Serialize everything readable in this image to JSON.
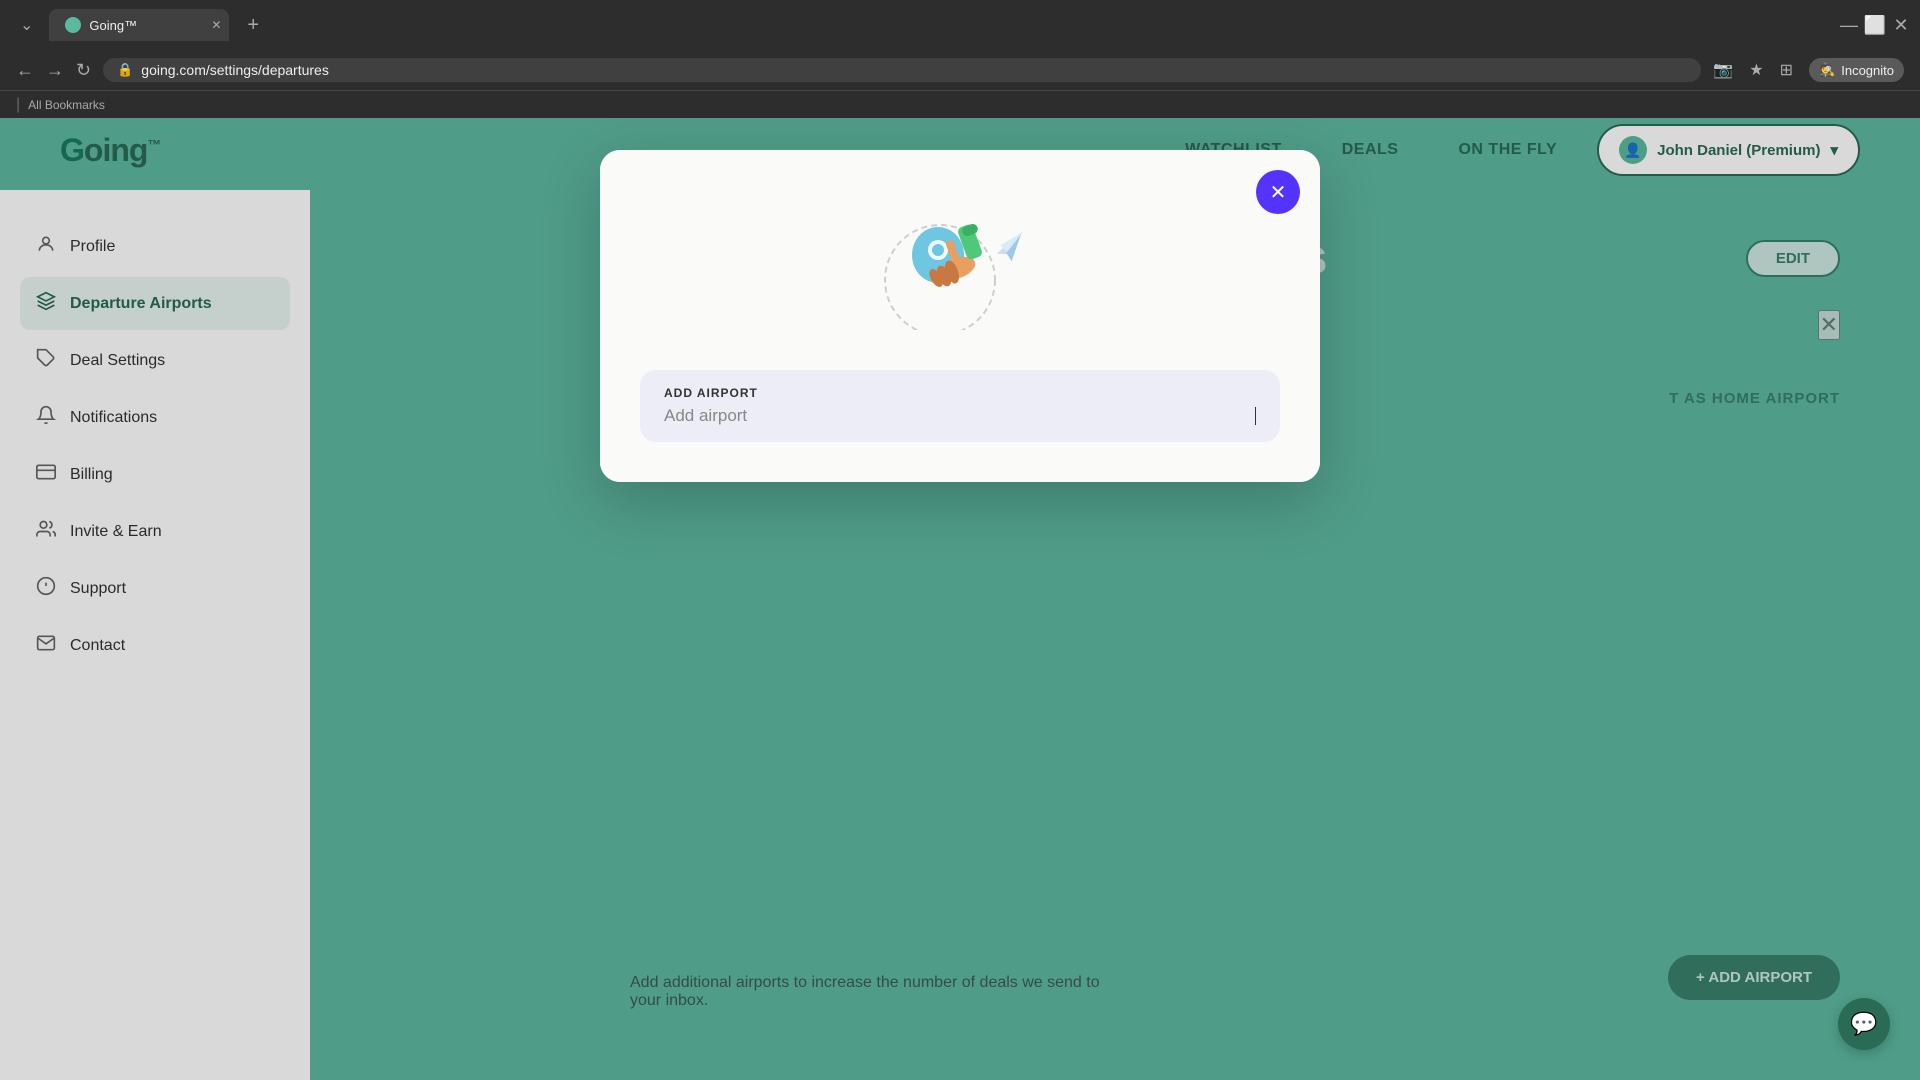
{
  "browser": {
    "tab_title": "Going™",
    "url": "going.com/settings/departures",
    "new_tab_label": "+",
    "incognito_label": "Incognito",
    "bookmarks_divider": "|",
    "bookmarks_label": "All Bookmarks"
  },
  "navbar": {
    "logo": "Going™",
    "links": [
      {
        "label": "WATCHLIST",
        "key": "watchlist"
      },
      {
        "label": "DEALS",
        "key": "deals"
      },
      {
        "label": "ON THE FLY",
        "key": "on-the-fly"
      }
    ],
    "user_button": "John Daniel (Premium)",
    "chevron": "▾"
  },
  "sidebar": {
    "items": [
      {
        "label": "Profile",
        "icon": "👤",
        "key": "profile",
        "active": false
      },
      {
        "label": "Departure Airports",
        "icon": "✈",
        "key": "departure-airports",
        "active": true
      },
      {
        "label": "Deal Settings",
        "icon": "🏷",
        "key": "deal-settings",
        "active": false
      },
      {
        "label": "Notifications",
        "icon": "🔔",
        "key": "notifications",
        "active": false
      },
      {
        "label": "Billing",
        "icon": "💳",
        "key": "billing",
        "active": false
      },
      {
        "label": "Invite & Earn",
        "icon": "👥",
        "key": "invite-earn",
        "active": false
      },
      {
        "label": "Support",
        "icon": "ℹ",
        "key": "support",
        "active": false
      },
      {
        "label": "Contact",
        "icon": "✉",
        "key": "contact",
        "active": false
      }
    ]
  },
  "page": {
    "title": "Departure Airports",
    "edit_button": "EDIT",
    "set_home_label": "T AS HOME AIRPORT",
    "add_airport_label": "+ ADD AIRPORT",
    "additional_text": "Add additional airports to increase the number of deals we send to your inbox."
  },
  "modal": {
    "close_icon": "✕",
    "field_label": "ADD AIRPORT",
    "field_placeholder": "Add airport",
    "cursor": "|"
  },
  "chat": {
    "icon": "💬"
  }
}
